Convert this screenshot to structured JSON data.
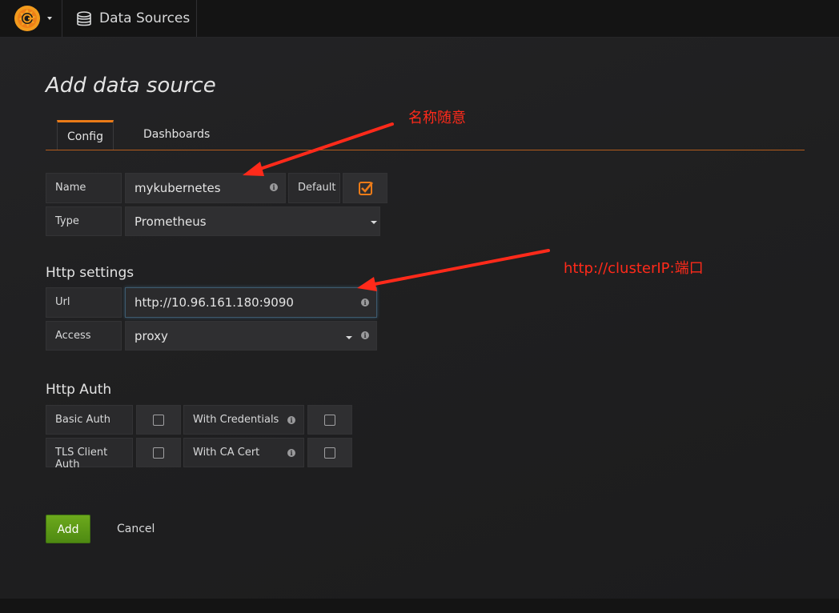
{
  "topbar": {
    "logo_icon": "grafana-logo-icon",
    "breadcrumb_icon": "database-icon",
    "breadcrumb_label": "Data Sources"
  },
  "page": {
    "title": "Add data source",
    "tabs": [
      {
        "label": "Config",
        "active": true
      },
      {
        "label": "Dashboards",
        "active": false
      }
    ]
  },
  "form": {
    "name": {
      "label": "Name",
      "value": "mykubernetes"
    },
    "default": {
      "label": "Default",
      "checked": true
    },
    "type": {
      "label": "Type",
      "value": "Prometheus"
    }
  },
  "http_settings": {
    "heading": "Http settings",
    "url": {
      "label": "Url",
      "value": "http://10.96.161.180:9090"
    },
    "access": {
      "label": "Access",
      "value": "proxy"
    }
  },
  "http_auth": {
    "heading": "Http Auth",
    "basic_auth": {
      "label": "Basic Auth",
      "checked": false
    },
    "with_credentials": {
      "label": "With Credentials",
      "checked": false
    },
    "tls_client_auth": {
      "label": "TLS Client Auth",
      "checked": false
    },
    "with_ca_cert": {
      "label": "With CA Cert",
      "checked": false
    }
  },
  "actions": {
    "add_label": "Add",
    "cancel_label": "Cancel"
  },
  "annotations": {
    "name_note": "名称随意",
    "url_note": "http://clusterIP:端口"
  },
  "colors": {
    "accent": "#eb7b18",
    "add_button": "#5c9a16",
    "annotation": "#ff2a1a"
  }
}
